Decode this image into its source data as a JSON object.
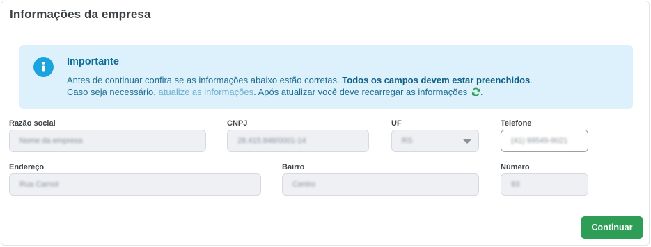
{
  "section": {
    "title": "Informações da empresa"
  },
  "alert": {
    "title": "Importante",
    "line1_text": "Antes de continuar confira se as informações abaixo estão corretas. ",
    "line1_bold": "Todos os campos devem estar preenchidos",
    "line1_end": ".",
    "line2_start": "Caso seja necessário, ",
    "line2_link": "atualize as informações",
    "line2_mid": ". Após atualizar você deve recarregar as informações ",
    "line2_end": ".",
    "icon": "info-icon",
    "refresh_icon": "refresh-icon",
    "colors": {
      "background": "#dcf1fb",
      "icon": "#1aa3dc",
      "refresh": "#2e9e57"
    }
  },
  "fields": {
    "razao_social": {
      "label": "Razão social",
      "value": "Nome da empresa"
    },
    "cnpj": {
      "label": "CNPJ",
      "value": "28.415.848/0001-14"
    },
    "uf": {
      "label": "UF",
      "value": "RS"
    },
    "telefone": {
      "label": "Telefone",
      "value": "(41) 99549-9021"
    },
    "endereco": {
      "label": "Endereço",
      "value": "Rua Carnot"
    },
    "bairro": {
      "label": "Bairro",
      "value": "Centro"
    },
    "numero": {
      "label": "Número",
      "value": "93"
    }
  },
  "actions": {
    "continue_label": "Continuar",
    "color": "#2e9e57"
  }
}
